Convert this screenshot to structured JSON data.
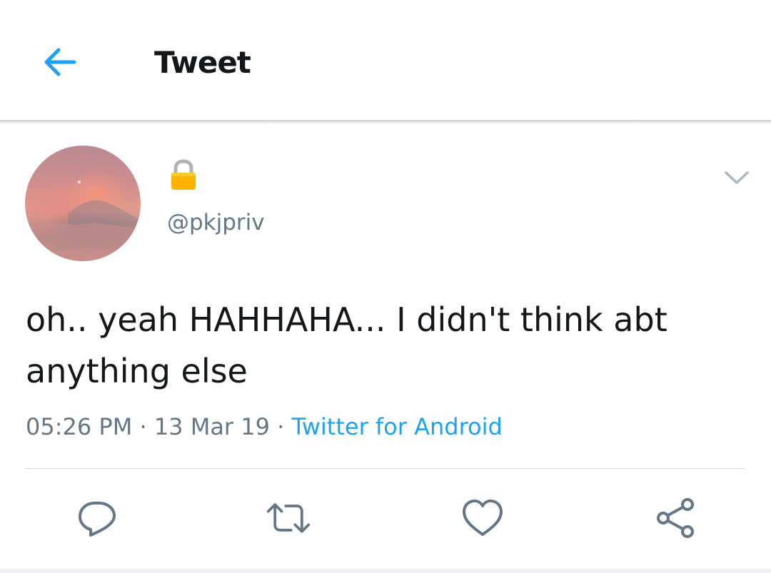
{
  "header": {
    "title": "Tweet",
    "back_icon": "arrow-left-icon"
  },
  "tweet": {
    "author_handle": "@pkjpriv",
    "author_name_icon": "lock-icon",
    "text": "oh.. yeah HAHHAHA... I didn't think abt anything else",
    "time": "05:26 PM",
    "date": "13 Mar 19",
    "separator": "·",
    "source": "Twitter for Android",
    "menu_icon": "chevron-down-icon"
  },
  "actions": [
    {
      "name": "reply",
      "icon": "reply-icon"
    },
    {
      "name": "retweet",
      "icon": "retweet-icon"
    },
    {
      "name": "like",
      "icon": "heart-icon"
    },
    {
      "name": "share",
      "icon": "share-icon"
    }
  ],
  "colors": {
    "accent": "#1da1f2",
    "secondary_text": "#657786",
    "icon_gray": "#657786",
    "lock_yellow": "#ffb300"
  }
}
